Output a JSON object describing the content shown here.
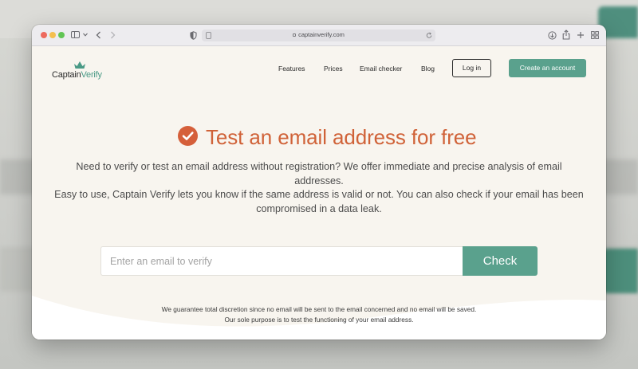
{
  "browser": {
    "url": "captainverify.com",
    "controls": {
      "sidebar_icon": "sidebar-icon",
      "back_icon": "chevron-left-icon",
      "forward_icon": "chevron-right-icon",
      "shield_icon": "shield-icon",
      "reload_icon": "reload-icon",
      "download_icon": "download-icon",
      "share_icon": "share-icon",
      "new_tab_icon": "plus-icon",
      "tab_overview_icon": "grid-icon"
    }
  },
  "logo": {
    "part1": "Captain",
    "part2": "Verify"
  },
  "nav": {
    "items": [
      {
        "label": "Features"
      },
      {
        "label": "Prices"
      },
      {
        "label": "Email checker"
      },
      {
        "label": "Blog"
      }
    ],
    "login_label": "Log in",
    "create_label": "Create an account"
  },
  "hero": {
    "title": "Test an email address for free",
    "description_line1": "Need to verify or test an email address without registration? We offer immediate and precise analysis of email addresses.",
    "description_line2": "Easy to use, Captain Verify lets you know if the same address is valid or not. You can also check if your email has been",
    "description_line3": "compromised in a data leak."
  },
  "form": {
    "placeholder": "Enter an email to verify",
    "value": "",
    "button_label": "Check"
  },
  "guarantee": {
    "line1": "We guarantee total discretion since no email will be sent to the email concerned and no email will be saved.",
    "line2": "Our sole purpose is to test the functioning of your email address."
  },
  "colors": {
    "accent": "#5aa18d",
    "title": "#d06238",
    "page_background": "#f8f5ef"
  }
}
